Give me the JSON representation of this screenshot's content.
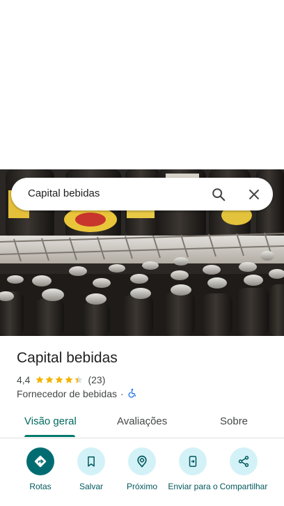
{
  "search": {
    "query": "Capital bebidas"
  },
  "place": {
    "name": "Capital bebidas",
    "rating": "4,4",
    "rating_fraction": 0.88,
    "review_count": "(23)",
    "category": "Fornecedor de bebidas",
    "separator": "·",
    "accessibility_icon": "wheelchair-icon"
  },
  "tabs": [
    {
      "label": "Visão geral",
      "active": true
    },
    {
      "label": "Avaliações",
      "active": false
    },
    {
      "label": "Sobre",
      "active": false
    }
  ],
  "actions": [
    {
      "label": "Rotas",
      "icon": "directions-icon"
    },
    {
      "label": "Salvar",
      "icon": "bookmark-icon"
    },
    {
      "label": "Próximo",
      "icon": "nearby-pin-icon"
    },
    {
      "label": "Enviar para o",
      "icon": "send-to-phone-icon"
    },
    {
      "label": "Compartilhar",
      "icon": "share-icon"
    }
  ],
  "colors": {
    "accent": "#00796b",
    "action_primary": "#006c72",
    "action_secondary": "#d3f2f7",
    "star": "#f4b400"
  }
}
